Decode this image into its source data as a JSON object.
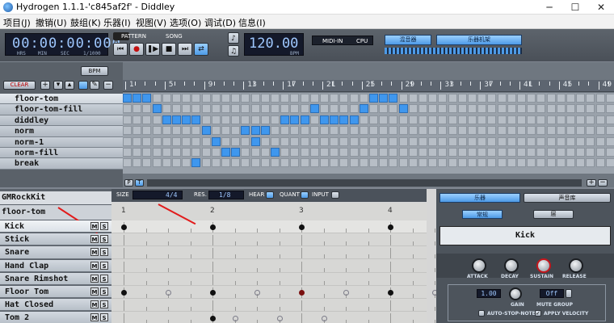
{
  "window": {
    "title": "Hydrogen 1.1.1-'c845af2f' - Diddley",
    "minimize": "─",
    "maximize": "☐",
    "close": "✕"
  },
  "menu": [
    "项目(J)",
    "撤销(U)",
    "鼓组(K)",
    "乐器(I)",
    "视图(V)",
    "选项(O)",
    "调试(D)",
    "信息(I)"
  ],
  "toolbar": {
    "time": "00:00:00:000",
    "time_units": [
      "HRS",
      "MIN",
      "SEC",
      "1/1000"
    ],
    "pattern_label": "PATTERN",
    "song_label": "SONG",
    "bpm_value": "120.00",
    "bpm_label": "BPM",
    "midi_label": "MIDI-IN",
    "cpu_label": "CPU",
    "mixer_label": "混音器",
    "instrument_rack_label": "乐器机架"
  },
  "song_editor": {
    "bpm_button": "BPM",
    "clear_button": "CLEAR",
    "ruler_ticks": [
      "1",
      "5",
      "9",
      "13",
      "17",
      "21",
      "25",
      "29",
      "33",
      "37",
      "41",
      "45",
      "49"
    ],
    "patterns": [
      "floor-tom",
      "floor-tom-fill",
      "diddley",
      "norm",
      "norm-1",
      "norm-fill",
      "break"
    ],
    "mode_p": "P",
    "mode_t": "T"
  },
  "pattern_editor": {
    "kit_name": "GMRockKit",
    "pattern_name": "floor-tom",
    "size_label": "SIZE",
    "size_value": "4/4",
    "res_label": "RES.",
    "res_value": "1/8",
    "hear_label": "HEAR",
    "quant_label": "QUANT",
    "input_label": "INPUT",
    "beat_numbers": [
      "1",
      "2",
      "3",
      "4"
    ],
    "instruments": [
      "Kick",
      "Stick",
      "Snare",
      "Hand Clap",
      "Snare Rimshot",
      "Floor Tom",
      "Hat Closed",
      "Tom 2"
    ],
    "mute_label": "M",
    "solo_label": "S"
  },
  "instrument_panel": {
    "tab_instrument": "乐器",
    "tab_sound_library": "声音库",
    "subtab_general": "常规",
    "subtab_layer": "层",
    "instrument_name": "Kick",
    "knobs": [
      "ATTACK",
      "DECAY",
      "SUSTAIN",
      "RELEASE"
    ],
    "gain_value": "1.00",
    "gain_label": "GAIN",
    "mute_group_value": "Off",
    "mute_group_label": "MUTE GROUP",
    "auto_stop_note": "AUTO-STOP-NOTE",
    "apply_velocity": "APPLY VELOCITY"
  },
  "colors": {
    "active_cell": "#3f97ee",
    "annotation_arrow": "#e21b1b",
    "lcd_bg": "#14192a"
  }
}
